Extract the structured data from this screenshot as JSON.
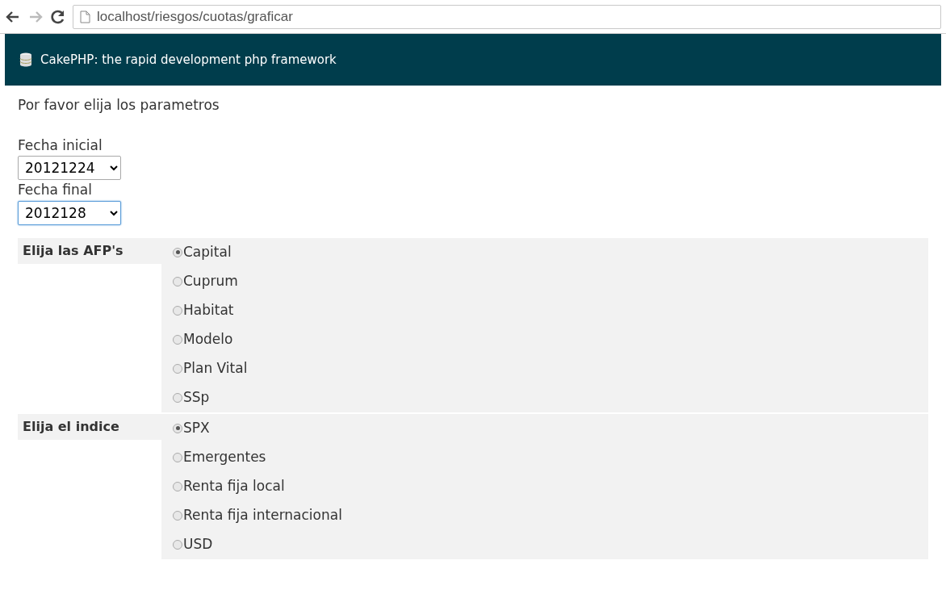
{
  "browser": {
    "url": "localhost/riesgos/cuotas/graficar"
  },
  "header": {
    "title": "CakePHP: the rapid development php framework"
  },
  "intro": "Por favor elija los parametros",
  "dates": [
    {
      "label": "Fecha inicial",
      "value": "20121224",
      "focused": false
    },
    {
      "label": "Fecha final",
      "value": "2012128",
      "focused": true
    }
  ],
  "groups": [
    {
      "label": "Elija las AFP's",
      "options": [
        {
          "label": "Capital",
          "selected": true
        },
        {
          "label": "Cuprum",
          "selected": false
        },
        {
          "label": "Habitat",
          "selected": false
        },
        {
          "label": "Modelo",
          "selected": false
        },
        {
          "label": "Plan Vital",
          "selected": false
        },
        {
          "label": "SSp",
          "selected": false
        }
      ]
    },
    {
      "label": "Elija el indice",
      "options": [
        {
          "label": "SPX",
          "selected": true
        },
        {
          "label": "Emergentes",
          "selected": false
        },
        {
          "label": "Renta fija local",
          "selected": false
        },
        {
          "label": "Renta fija internacional",
          "selected": false
        },
        {
          "label": "USD",
          "selected": false
        }
      ]
    }
  ]
}
